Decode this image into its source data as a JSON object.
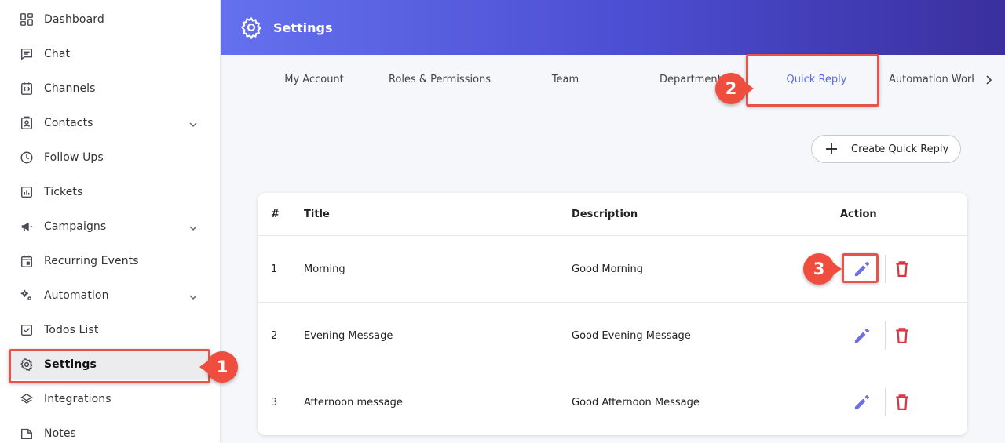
{
  "sidebar": {
    "items": [
      {
        "label": "Dashboard",
        "icon": "dashboard-icon"
      },
      {
        "label": "Chat",
        "icon": "chat-icon"
      },
      {
        "label": "Channels",
        "icon": "channels-icon"
      },
      {
        "label": "Contacts",
        "icon": "contacts-icon",
        "expandable": true
      },
      {
        "label": "Follow Ups",
        "icon": "clock-icon"
      },
      {
        "label": "Tickets",
        "icon": "tickets-icon"
      },
      {
        "label": "Campaigns",
        "icon": "megaphone-icon",
        "expandable": true
      },
      {
        "label": "Recurring Events",
        "icon": "calendar-icon"
      },
      {
        "label": "Automation",
        "icon": "automation-icon",
        "expandable": true
      },
      {
        "label": "Todos List",
        "icon": "checkbox-icon"
      },
      {
        "label": "Settings",
        "icon": "gear-icon",
        "active": true
      },
      {
        "label": "Integrations",
        "icon": "layers-icon"
      },
      {
        "label": "Notes",
        "icon": "notes-icon"
      }
    ]
  },
  "header": {
    "title": "Settings",
    "icon": "gear-icon"
  },
  "tabs": [
    {
      "label": "My Account"
    },
    {
      "label": "Roles & Permissions"
    },
    {
      "label": "Team"
    },
    {
      "label": "Departments"
    },
    {
      "label": "Quick Reply",
      "active": true
    },
    {
      "label": "Automation Workflows"
    }
  ],
  "create_button": {
    "label": "Create Quick Reply"
  },
  "table": {
    "headers": [
      "#",
      "Title",
      "Description",
      "Action"
    ],
    "rows": [
      {
        "num": "1",
        "title": "Morning",
        "description": "Good Morning"
      },
      {
        "num": "2",
        "title": "Evening Message",
        "description": "Good Evening Message"
      },
      {
        "num": "3",
        "title": "Afternoon message",
        "description": "Good Afternoon Message"
      }
    ]
  },
  "annotations": {
    "step1": "1",
    "step2": "2",
    "step3": "3"
  },
  "colors": {
    "accent": "#5a67e8",
    "header_start": "#6471ee",
    "header_end": "#3a2f9e",
    "danger": "#e0323c",
    "annotation": "#ef4e3f"
  }
}
